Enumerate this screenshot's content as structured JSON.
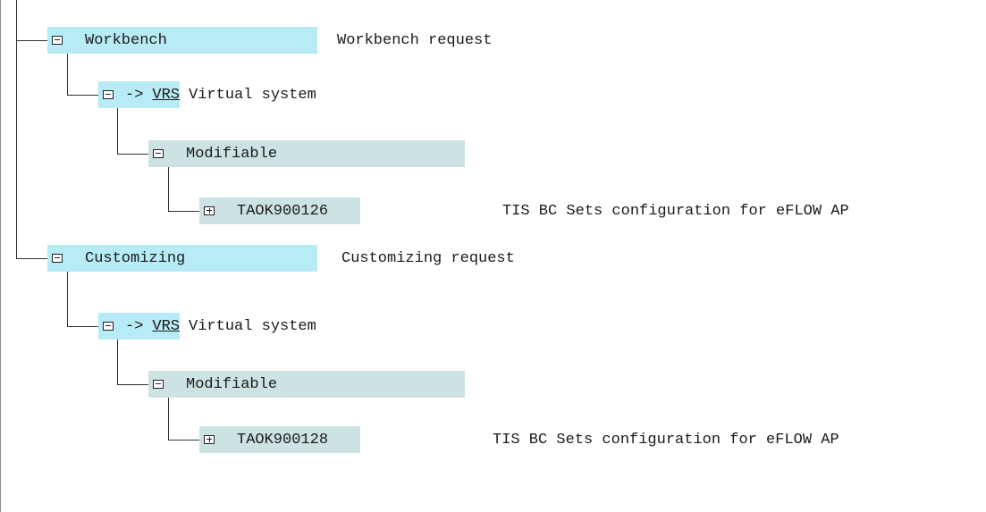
{
  "tree": {
    "workbench": {
      "label": "Workbench",
      "description": "Workbench request",
      "target": {
        "arrow": "->",
        "code": "VRS",
        "name": "Virtual system"
      },
      "status": {
        "label": "Modifiable"
      },
      "request": {
        "id": "TAOK900126",
        "description": "TIS BC Sets configuration for eFLOW AP"
      }
    },
    "customizing": {
      "label": "Customizing",
      "description": "Customizing request",
      "target": {
        "arrow": "->",
        "code": "VRS",
        "name": "Virtual system"
      },
      "status": {
        "label": "Modifiable"
      },
      "request": {
        "id": "TAOK900128",
        "description": "TIS BC Sets configuration for eFLOW AP"
      }
    }
  },
  "colors": {
    "highlight_cyan": "#b7ebf6",
    "highlight_teal": "#cde3e3",
    "tree_line": "#333333"
  },
  "icons": {
    "expanded": "folder-expanded-icon",
    "collapsed": "folder-collapsed-icon"
  }
}
